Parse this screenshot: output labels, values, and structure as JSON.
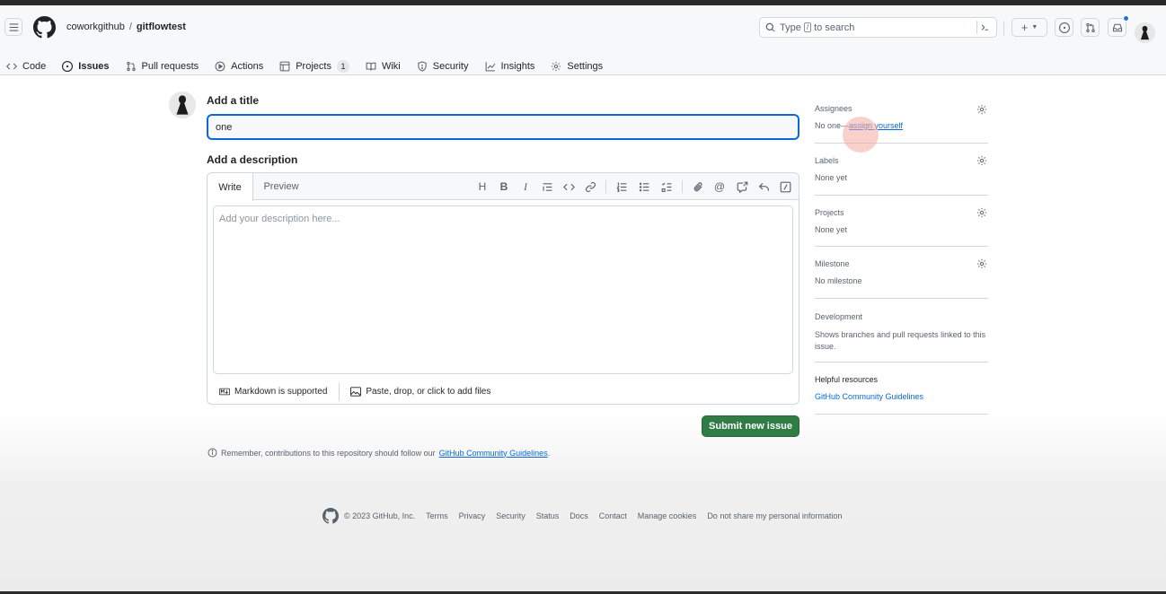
{
  "header": {
    "owner": "coworkgithub",
    "separator": "/",
    "repo": "gitflowtest",
    "search": {
      "prefix": "Type",
      "key": "/",
      "suffix": "to search",
      "command_icon": "terminal-icon"
    },
    "plus_label": "+"
  },
  "tabs": [
    {
      "label": "Code",
      "icon": "code-icon"
    },
    {
      "label": "Issues",
      "icon": "issue-opened-icon",
      "selected": true
    },
    {
      "label": "Pull requests",
      "icon": "git-pull-request-icon"
    },
    {
      "label": "Actions",
      "icon": "play-icon"
    },
    {
      "label": "Projects",
      "icon": "table-icon",
      "counter": "1"
    },
    {
      "label": "Wiki",
      "icon": "book-icon"
    },
    {
      "label": "Security",
      "icon": "shield-icon"
    },
    {
      "label": "Insights",
      "icon": "graph-icon"
    },
    {
      "label": "Settings",
      "icon": "gear-icon"
    }
  ],
  "form": {
    "title_label": "Add a title",
    "title_value": "one",
    "description_label": "Add a description",
    "write_tab": "Write",
    "preview_tab": "Preview",
    "description_placeholder": "Add your description here...",
    "markdown_note": "Markdown is supported",
    "attach_note": "Paste, drop, or click to add files",
    "submit_label": "Submit new issue",
    "reminder_prefix": "Remember, contributions to this repository should follow our",
    "reminder_link": "GitHub Community Guidelines",
    "reminder_suffix": "."
  },
  "sidebar": {
    "assignees": {
      "title": "Assignees",
      "value_prefix": "No one—",
      "value_link": "assign yourself"
    },
    "labels": {
      "title": "Labels",
      "value": "None yet"
    },
    "projects": {
      "title": "Projects",
      "value": "None yet"
    },
    "milestone": {
      "title": "Milestone",
      "value": "No milestone"
    },
    "development": {
      "title": "Development",
      "value": "Shows branches and pull requests linked to this issue."
    },
    "helpful": {
      "title": "Helpful resources",
      "link": "GitHub Community Guidelines"
    }
  },
  "footer": {
    "copyright": "© 2023 GitHub, Inc.",
    "links": [
      "Terms",
      "Privacy",
      "Security",
      "Status",
      "Docs",
      "Contact",
      "Manage cookies",
      "Do not share my personal information"
    ]
  },
  "colors": {
    "accent_blue": "#0969da",
    "submit_green": "#2f7d45",
    "selected_tab_underline": "#fd8c73"
  }
}
